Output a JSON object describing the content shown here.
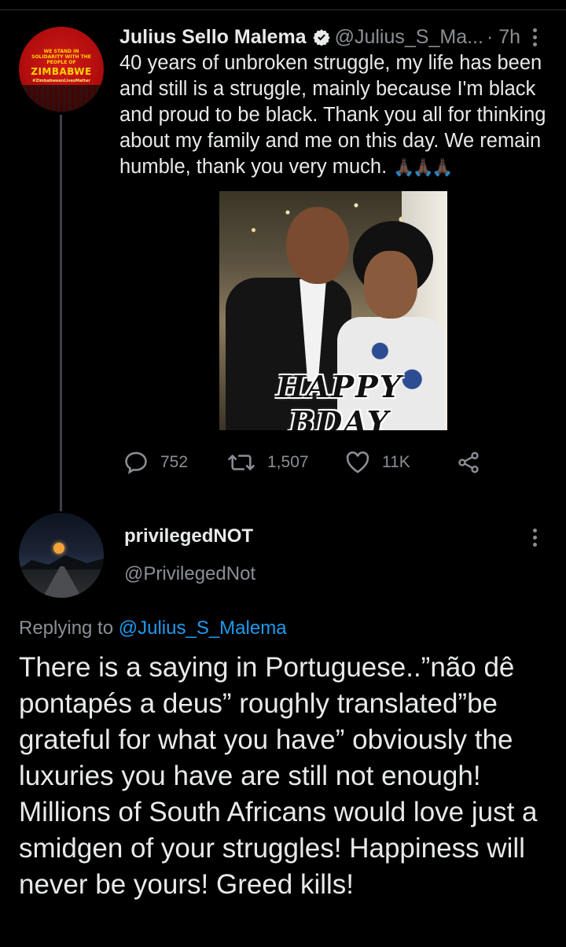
{
  "parent_tweet": {
    "author_name": "Julius Sello Malema",
    "handle": "@Julius_S_Ma...",
    "time": "· 7h",
    "text": "40 years of unbroken struggle, my life has been and still is a struggle, mainly because I'm black and proud to be black. Thank you all for thinking about my family and me on this day. We remain humble, thank you very much.",
    "emoji": "🙏🏿🙏🏿🙏🏿",
    "avatar_text": {
      "line1": "WE STAND IN SOLIDARITY WITH THE PEOPLE OF",
      "line2": "ZIMBABWE",
      "line3": "#ZimbabweanLivesMatter"
    },
    "image_caption": "HAPPY BDAY",
    "stats": {
      "replies": "752",
      "retweets": "1,507",
      "likes": "11K"
    }
  },
  "reply_tweet": {
    "author_name": "privilegedNOT",
    "handle": "@PrivilegedNot",
    "replying_prefix": "Replying to",
    "replying_to": "@Julius_S_Malema",
    "text": "There is a saying in Portuguese..”não dê pontapés a deus” roughly translated”be grateful for what you have” obviously the luxuries you have are still not enough! Millions of South Africans would love just a smidgen of your struggles! Happiness will never be yours! Greed kills!"
  },
  "colors": {
    "background": "#000000",
    "text": "#e7e9ea",
    "muted": "#8b8f94",
    "link": "#1d9bf0",
    "thread_line": "#3d4146"
  },
  "icons": [
    "verified-badge-icon",
    "more-vertical-icon",
    "reply-icon",
    "retweet-icon",
    "like-icon",
    "share-icon"
  ]
}
